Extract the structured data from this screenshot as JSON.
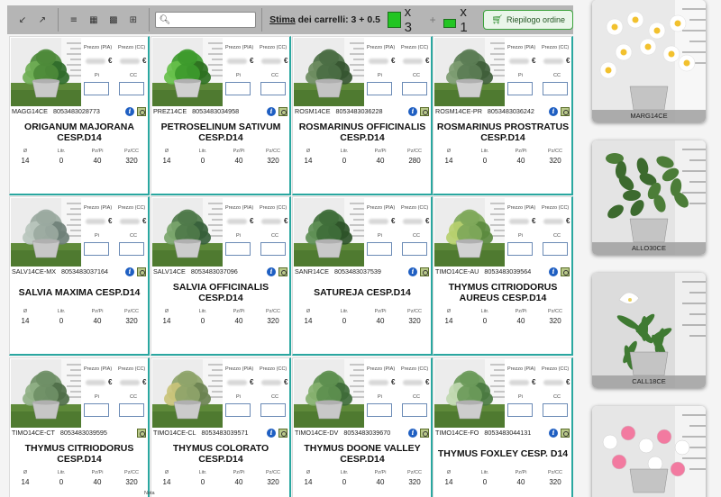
{
  "toolbar": {
    "stima_prefix": "Stima",
    "stima_suffix": " dei carrelli: 3 + 0.5",
    "cart_full_count": "x 3",
    "plus": "+",
    "cart_half_count": "x 1",
    "riepilogo_label": "Riepilogo ordine",
    "search_value": "",
    "search_placeholder": ""
  },
  "labels": {
    "prezzo_pia": "Prezzo (PIA)",
    "prezzo_cc": "Prezzo (CC)",
    "currency": "€",
    "pi": "Pi",
    "cc": "CC",
    "spec_diam": "Ø",
    "spec_litr": "Litr.",
    "spec_pzpi": "Pz/Pi",
    "spec_pzcc": "Pz/CC",
    "nota": "Nota"
  },
  "products": [
    {
      "code": "MAGG14CE",
      "ean": "8053483028773",
      "name": "ORIGANUM MAJORANA CESP.D14",
      "diam": "14",
      "litr": "0",
      "pzpi": "40",
      "pzcc": "320",
      "info": true
    },
    {
      "code": "PREZ14CE",
      "ean": "8053483034958",
      "name": "PETROSELINUM SATIVUM CESP.D14",
      "diam": "14",
      "litr": "0",
      "pzpi": "40",
      "pzcc": "320",
      "info": true
    },
    {
      "code": "ROSM14CE",
      "ean": "8053483036228",
      "name": "ROSMARINUS OFFICINALIS CESP.D14",
      "diam": "14",
      "litr": "0",
      "pzpi": "40",
      "pzcc": "280",
      "info": true
    },
    {
      "code": "ROSM14CE-PR",
      "ean": "8053483036242",
      "name": "ROSMARINUS PROSTRATUS CESP.D14",
      "diam": "14",
      "litr": "0",
      "pzpi": "40",
      "pzcc": "320",
      "info": true
    },
    {
      "code": "SALV14CE-MX",
      "ean": "8053483037164",
      "name": "SALVIA MAXIMA CESP.D14",
      "diam": "14",
      "litr": "0",
      "pzpi": "40",
      "pzcc": "320",
      "info": true
    },
    {
      "code": "SALV14CE",
      "ean": "8053483037096",
      "name": "SALVIA OFFICINALIS CESP.D14",
      "diam": "14",
      "litr": "0",
      "pzpi": "40",
      "pzcc": "320",
      "info": true
    },
    {
      "code": "SANR14CE",
      "ean": "8053483037539",
      "name": "SATUREJA CESP.D14",
      "diam": "14",
      "litr": "0",
      "pzpi": "40",
      "pzcc": "320",
      "info": true
    },
    {
      "code": "TIMO14CE-AU",
      "ean": "8053483039564",
      "name": "THYMUS CITRIODORUS AUREUS CESP.D14",
      "diam": "14",
      "litr": "0",
      "pzpi": "40",
      "pzcc": "320",
      "info": true
    },
    {
      "code": "TIMO14CE-CT",
      "ean": "8053483039595",
      "name": "THYMUS CITRIODORUS CESP.D14",
      "diam": "14",
      "litr": "0",
      "pzpi": "40",
      "pzcc": "320",
      "info": false
    },
    {
      "code": "TIMO14CE-CL",
      "ean": "8053483039571",
      "name": "THYMUS COLORATO CESP.D14",
      "diam": "14",
      "litr": "0",
      "pzpi": "40",
      "pzcc": "320",
      "info": true
    },
    {
      "code": "TIMO14CE-DV",
      "ean": "8053483039670",
      "name": "THYMUS DOONE VALLEY CESP.D14",
      "diam": "14",
      "litr": "0",
      "pzpi": "40",
      "pzcc": "320",
      "info": true
    },
    {
      "code": "TIMO14CE-FO",
      "ean": "8053483044131",
      "name": "THYMUS FOXLEY CESP. D14",
      "diam": "14",
      "litr": "0",
      "pzpi": "40",
      "pzcc": "320",
      "info": true
    }
  ],
  "gallery": [
    {
      "caption": "MARG14CE"
    },
    {
      "caption": "ALLO30CE"
    },
    {
      "caption": "CALL18CE"
    },
    {
      "caption": ""
    }
  ],
  "colors": {
    "accent_border": "#2aa7a0",
    "cart_green": "#22c522",
    "info_blue": "#1f5fc2"
  },
  "icons": {
    "collapse": "collapse-icon",
    "expand": "expand-icon",
    "list": "list-view-icon",
    "grid": "grid-view-icon",
    "search": "search-icon",
    "cart": "cart-icon",
    "info": "info-icon",
    "stock": "stock-icon"
  }
}
